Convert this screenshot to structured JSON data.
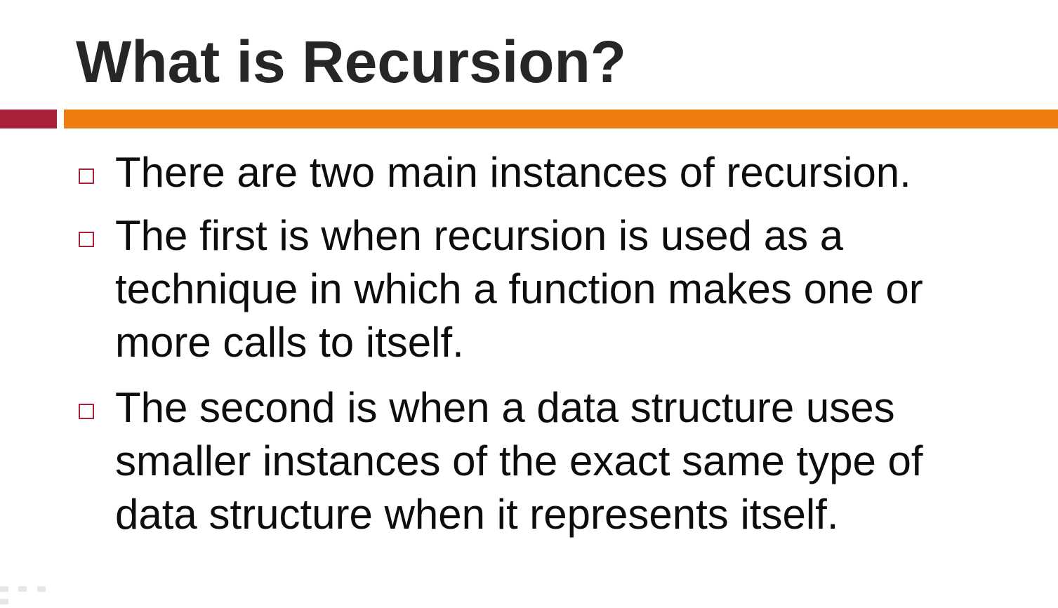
{
  "slide": {
    "title": "What is Recursion?",
    "bullets": [
      {
        "text": "There are two main instances of recursion."
      },
      {
        "text": "The first is when recursion is used as a technique in which a function makes one or more calls to itself."
      },
      {
        "text": "The second is when a data structure uses smaller instances of the exact same type of data structure when it represents itself."
      }
    ]
  },
  "colors": {
    "title_text": "#262626",
    "body_text": "#0d0d0d",
    "accent_left": "#a8203a",
    "accent_right": "#ed7d0e",
    "bullet_marker": "#a8203a",
    "background": "#ffffff"
  },
  "icons": {
    "bullet": "hollow-square-bullet-icon"
  }
}
